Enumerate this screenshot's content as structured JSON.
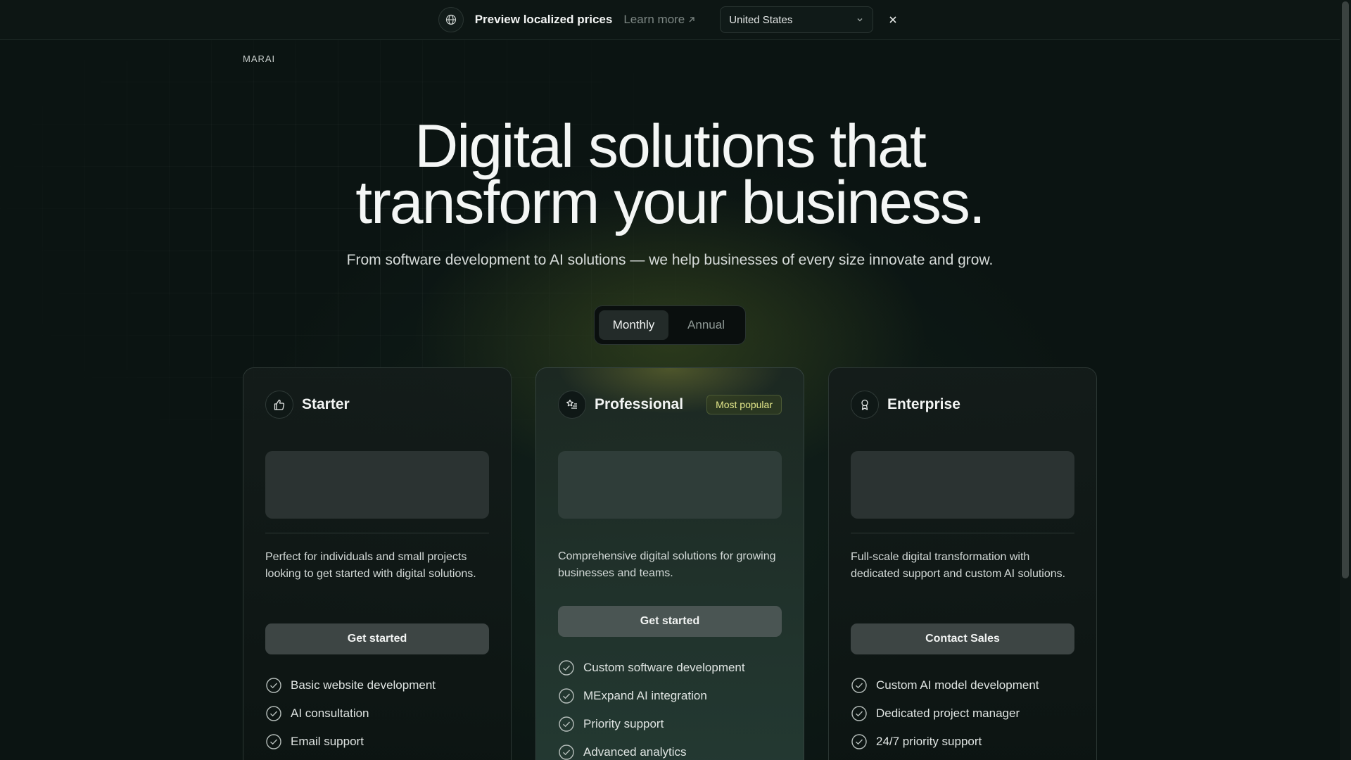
{
  "banner": {
    "title": "Preview localized prices",
    "learn_more": "Learn more",
    "country": "United States"
  },
  "logo": {
    "alt_text": "MARAI"
  },
  "hero": {
    "title_line1": "Digital solutions that",
    "title_line2": "transform your business.",
    "subtitle": "From software development to AI solutions — we help businesses of every size innovate and grow."
  },
  "billing_toggle": {
    "options": [
      "Monthly",
      "Annual"
    ],
    "selected": "Monthly"
  },
  "plans": [
    {
      "name": "Starter",
      "icon": "thumbs-up-icon",
      "description": "Perfect for individuals and small projects looking to get started with digital solutions.",
      "cta": "Get started",
      "features": [
        "Basic website development",
        "AI consultation",
        "Email support"
      ]
    },
    {
      "name": "Professional",
      "icon": "star-list-icon",
      "badge": "Most popular",
      "description": "Comprehensive digital solutions for growing businesses and teams.",
      "cta": "Get started",
      "features": [
        "Custom software development",
        "MExpand AI integration",
        "Priority support",
        "Advanced analytics"
      ]
    },
    {
      "name": "Enterprise",
      "icon": "award-icon",
      "description": "Full-scale digital transformation with dedicated support and custom AI solutions.",
      "cta": "Contact Sales",
      "features": [
        "Custom AI model development",
        "Dedicated project manager",
        "24/7 priority support"
      ]
    }
  ],
  "colors": {
    "background": "#0b1412",
    "card_border": "#2b3633",
    "badge_text": "#e4e88a",
    "button": "#3d4544"
  }
}
